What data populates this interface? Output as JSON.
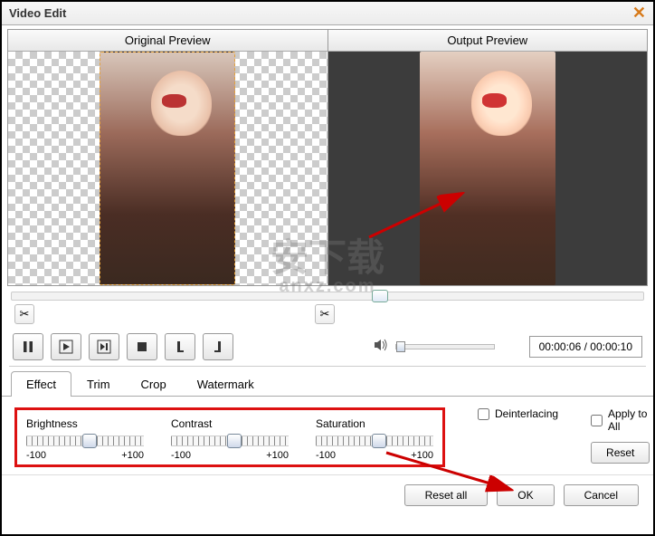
{
  "window": {
    "title": "Video Edit"
  },
  "previews": {
    "original_label": "Original Preview",
    "output_label": "Output Preview"
  },
  "playback": {
    "time_display": "00:00:06 / 00:00:10"
  },
  "tabs": {
    "effect": "Effect",
    "trim": "Trim",
    "crop": "Crop",
    "watermark": "Watermark",
    "active": "effect"
  },
  "effect": {
    "sliders": [
      {
        "label": "Brightness",
        "min": "-100",
        "max": "+100"
      },
      {
        "label": "Contrast",
        "min": "-100",
        "max": "+100"
      },
      {
        "label": "Saturation",
        "min": "-100",
        "max": "+100"
      }
    ],
    "deinterlacing_label": "Deinterlacing",
    "deinterlacing_checked": false,
    "apply_all_label": "Apply to All",
    "apply_all_checked": false,
    "reset_label": "Reset"
  },
  "footer": {
    "reset_all": "Reset all",
    "ok": "OK",
    "cancel": "Cancel"
  },
  "watermark_overlay": {
    "line1": "安下载",
    "line2": "anxz.com"
  }
}
